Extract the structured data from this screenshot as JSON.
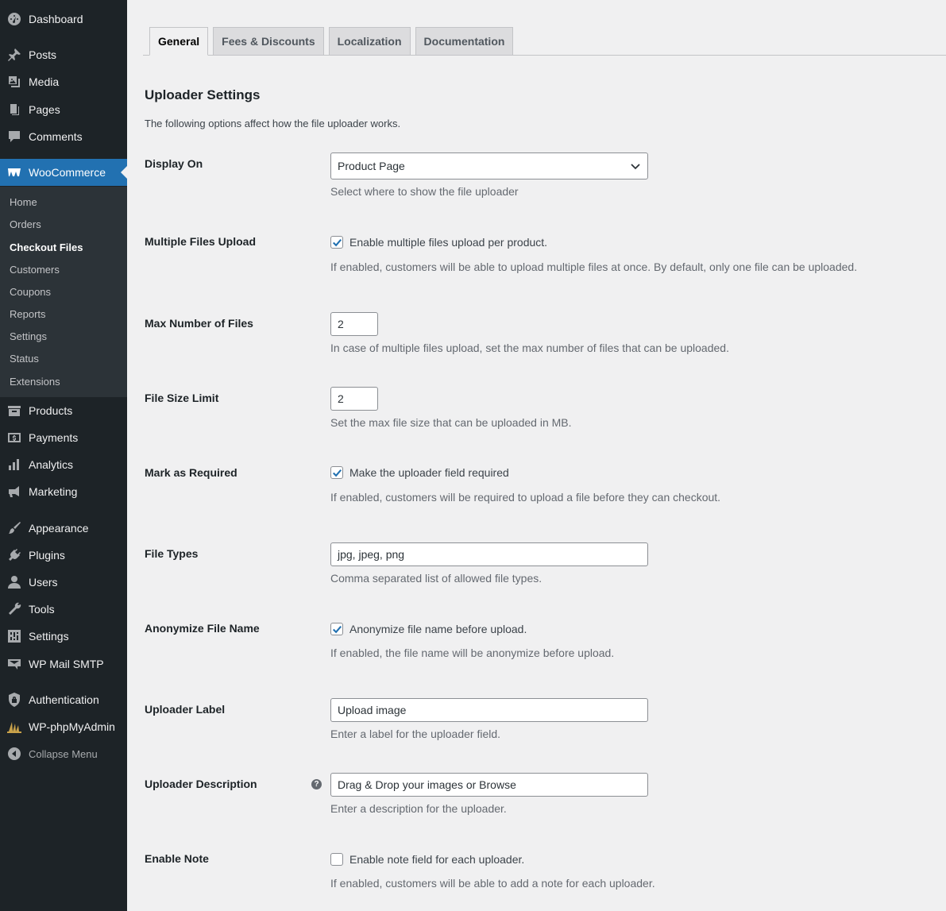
{
  "sidebar": {
    "menu": {
      "dashboard": "Dashboard",
      "posts": "Posts",
      "media": "Media",
      "pages": "Pages",
      "comments": "Comments",
      "woocommerce": "WooCommerce",
      "products": "Products",
      "payments": "Payments",
      "analytics": "Analytics",
      "marketing": "Marketing",
      "appearance": "Appearance",
      "plugins": "Plugins",
      "users": "Users",
      "tools": "Tools",
      "settings": "Settings",
      "wp_mail_smtp": "WP Mail SMTP",
      "authentication": "Authentication",
      "wp_phpmyadmin": "WP-phpMyAdmin",
      "collapse": "Collapse Menu"
    },
    "submenu": [
      "Home",
      "Orders",
      "Checkout Files",
      "Customers",
      "Coupons",
      "Reports",
      "Settings",
      "Status",
      "Extensions"
    ],
    "active_color": "#2271b1"
  },
  "tabs": [
    "General",
    "Fees & Discounts",
    "Localization",
    "Documentation"
  ],
  "section": {
    "title": "Uploader Settings",
    "description": "The following options affect how the file uploader works."
  },
  "fields": {
    "display_on": {
      "label": "Display On",
      "value": "Product Page",
      "description": "Select where to show the file uploader"
    },
    "multiple": {
      "label": "Multiple Files Upload",
      "checked": true,
      "checkbox_label": "Enable multiple files upload per product.",
      "description": "If enabled, customers will be able to upload multiple files at once. By default, only one file can be uploaded."
    },
    "max_files": {
      "label": "Max Number of Files",
      "value": "2",
      "description": "In case of multiple files upload, set the max number of files that can be uploaded."
    },
    "size_limit": {
      "label": "File Size Limit",
      "value": "2",
      "description": "Set the max file size that can be uploaded in MB."
    },
    "required": {
      "label": "Mark as Required",
      "checked": true,
      "checkbox_label": "Make the uploader field required",
      "description": "If enabled, customers will be required to upload a file before they can checkout."
    },
    "file_types": {
      "label": "File Types",
      "value": "jpg, jpeg, png",
      "description": "Comma separated list of allowed file types."
    },
    "anonymize": {
      "label": "Anonymize File Name",
      "checked": true,
      "checkbox_label": "Anonymize file name before upload.",
      "description": "If enabled, the file name will be anonymize before upload."
    },
    "uploader_label": {
      "label": "Uploader Label",
      "value": "Upload image",
      "description": "Enter a label for the uploader field."
    },
    "uploader_description": {
      "label": "Uploader Description",
      "value": "Drag & Drop your images or Browse",
      "description": "Enter a description for the uploader."
    },
    "enable_note": {
      "label": "Enable Note",
      "checked": false,
      "checkbox_label": "Enable note field for each uploader.",
      "description": "If enabled, customers will be able to add a note for each uploader."
    }
  }
}
